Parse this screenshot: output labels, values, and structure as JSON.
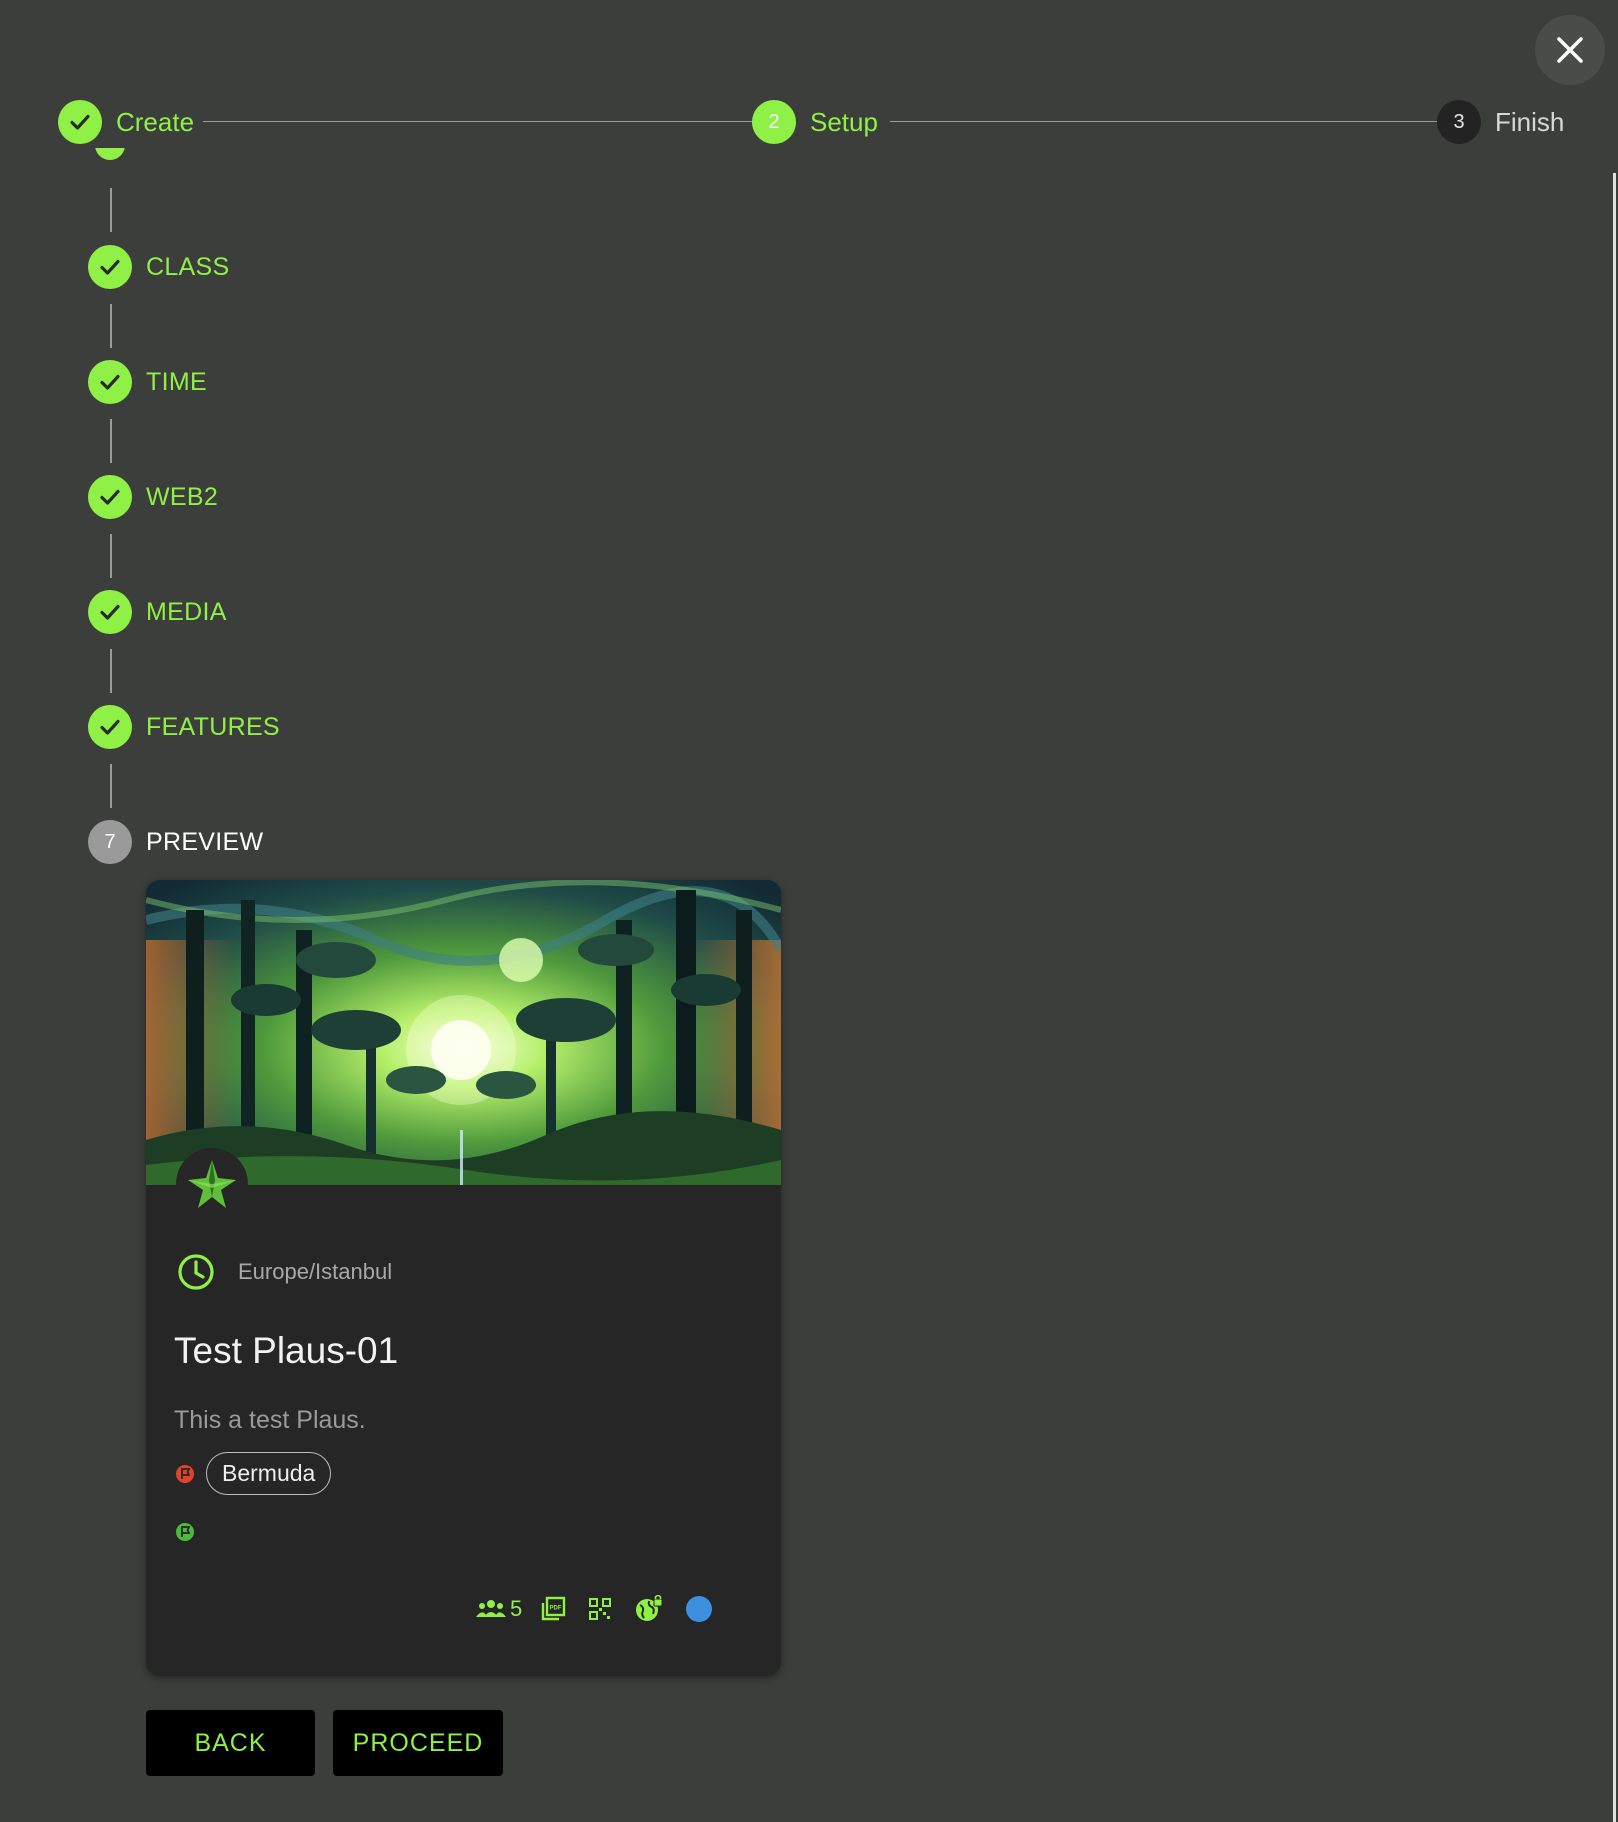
{
  "stepper": {
    "steps": [
      {
        "label": "Create",
        "number": "",
        "state": "done"
      },
      {
        "label": "Setup",
        "number": "2",
        "state": "active"
      },
      {
        "label": "Finish",
        "number": "3",
        "state": "pending"
      }
    ]
  },
  "vertical_steps": [
    {
      "label": "CLASS",
      "state": "done"
    },
    {
      "label": "TIME",
      "state": "done"
    },
    {
      "label": "WEB2",
      "state": "done"
    },
    {
      "label": "MEDIA",
      "state": "done"
    },
    {
      "label": "FEATURES",
      "state": "done"
    },
    {
      "label": "PREVIEW",
      "number": "7",
      "state": "active"
    }
  ],
  "card": {
    "timezone": "Europe/Istanbul",
    "title": "Test Plaus-01",
    "description": "This a test Plaus.",
    "tag": "Bermuda",
    "member_count": "5",
    "status_color": "#3d8fe0"
  },
  "buttons": {
    "back": "BACK",
    "proceed": "PROCEED"
  },
  "colors": {
    "accent": "#8ff046",
    "background": "#3c3e3c",
    "card": "#262626"
  },
  "icons": [
    "close-icon",
    "check-icon",
    "clock-icon",
    "flag-icon",
    "group-icon",
    "pdf-icon",
    "qr-code-icon",
    "globe-lock-icon",
    "star-logo-icon"
  ]
}
